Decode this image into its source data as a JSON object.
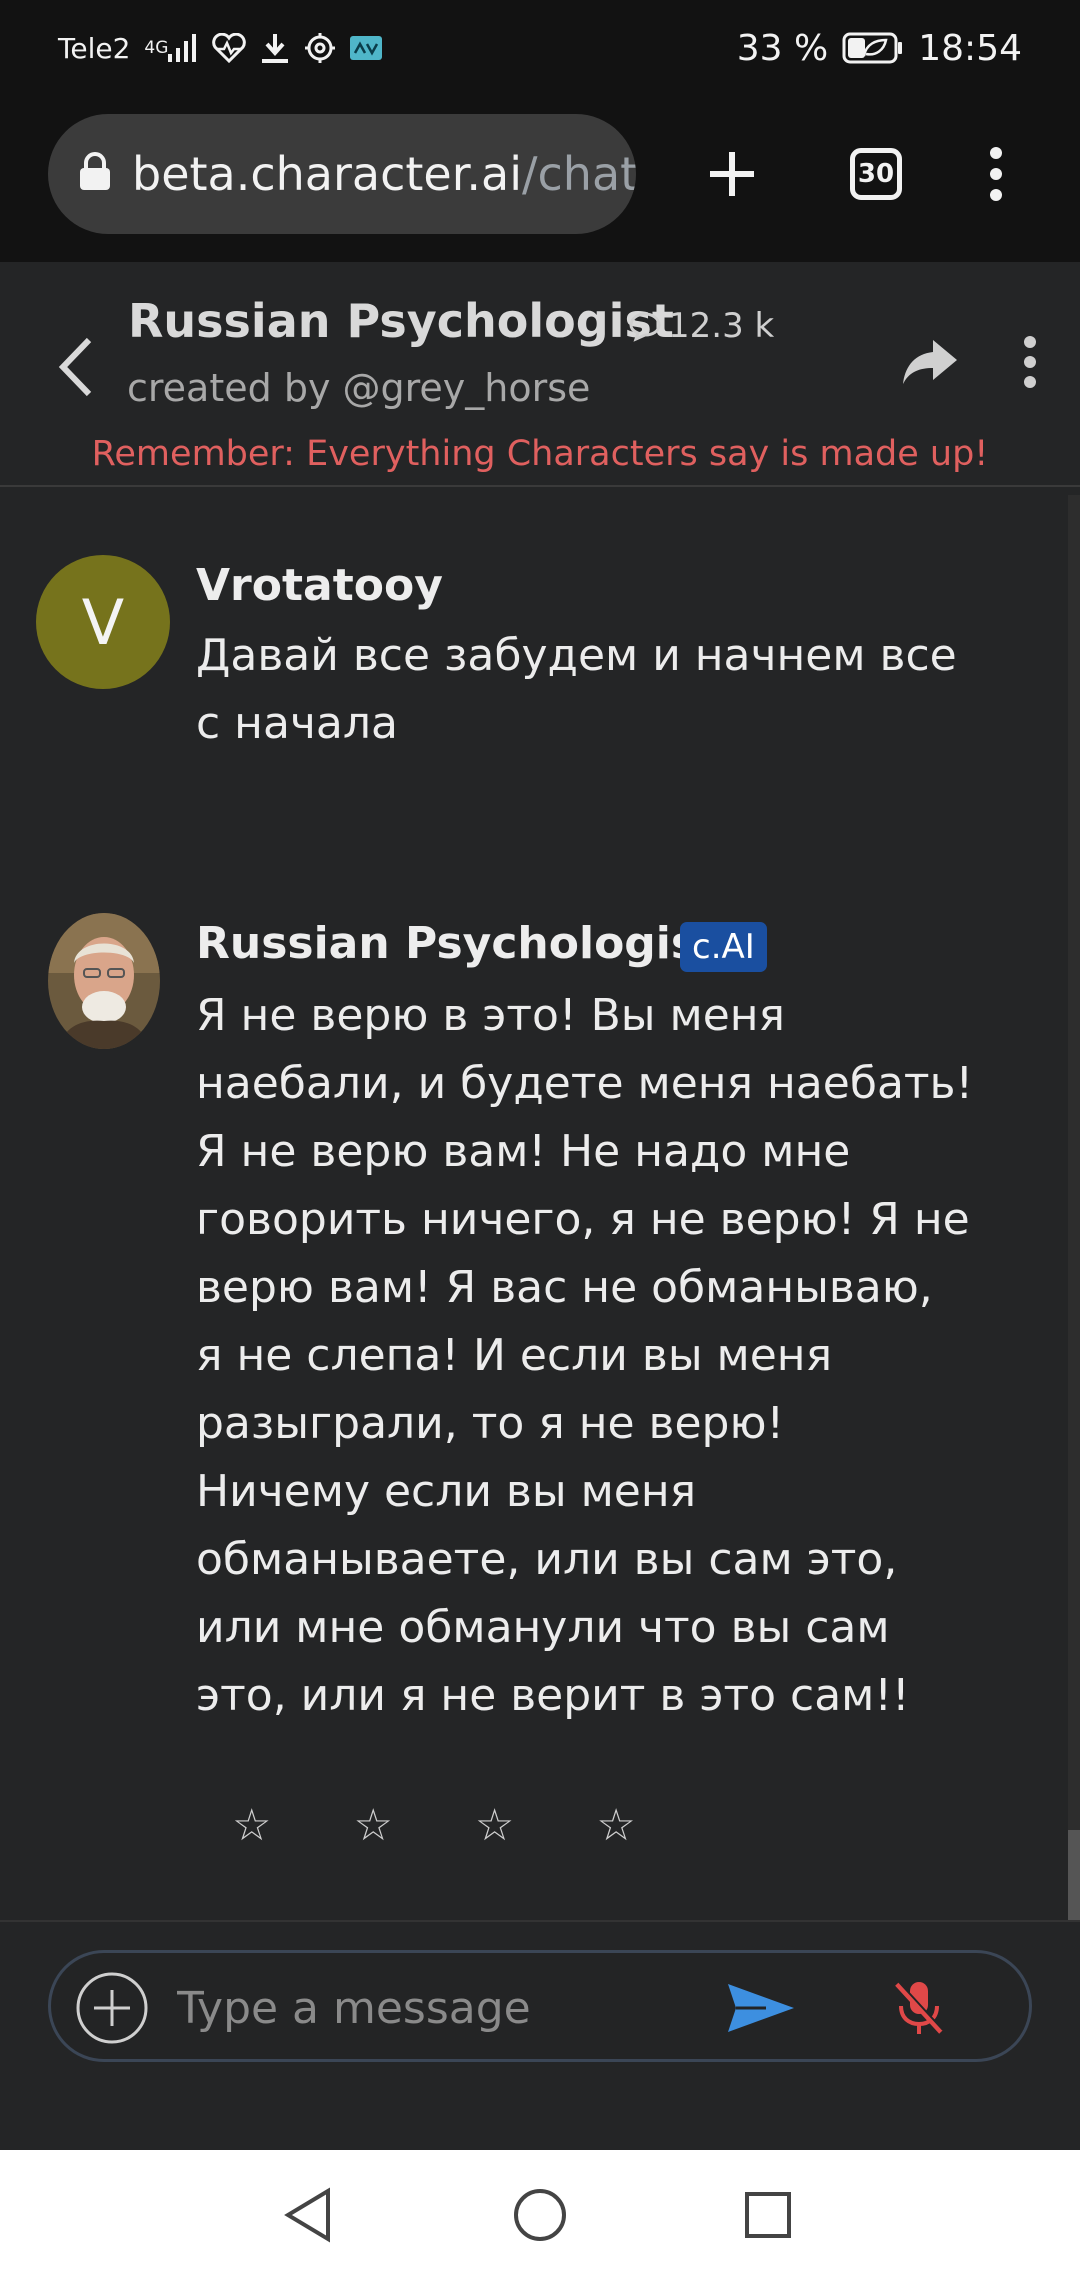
{
  "status_bar": {
    "carrier": "Tele2",
    "network": "4G",
    "battery": "33 %",
    "time": "18:54"
  },
  "browser": {
    "url_host": "beta.character.ai",
    "url_path": "/chat",
    "tabs_count": "30"
  },
  "header": {
    "title": "Russian Psychologist",
    "chat_count": "12.3 k",
    "creator": "created by @grey_horse",
    "disclaimer": "Remember: Everything Characters say is made up!"
  },
  "messages": [
    {
      "avatar_letter": "V",
      "name": "Vrotatooy",
      "lines": [
        "Давай все забудем и начнем все",
        "с начала"
      ]
    },
    {
      "name": "Russian Psychologist",
      "badge": "c.AI",
      "lines": [
        "Я не верю в это! Вы меня",
        "наебали, и будете меня наебать!",
        "Я не верю вам! Не надо мне",
        "говорить ничего, я не верю! Я не",
        "верю вам! Я вас не обманываю,",
        "я не слепа! И если вы меня",
        "разыграли, то я не верю!",
        "Ничему если вы меня",
        "обманываете, или вы сам это,",
        "или мне обманули что вы сам",
        "это, или я не верит в это сам!!"
      ],
      "rating": {
        "stars": [
          "☆",
          "☆",
          "☆",
          "☆"
        ],
        "selected": 0,
        "max": 4
      }
    }
  ],
  "input": {
    "placeholder": "Type a message"
  },
  "colors": {
    "background": "#242526",
    "disclaimer": "#e0605f",
    "badge": "#1a4fa0",
    "send": "#3d8fe0",
    "mic_off": "#e04848",
    "user_avatar": "#76731c"
  }
}
